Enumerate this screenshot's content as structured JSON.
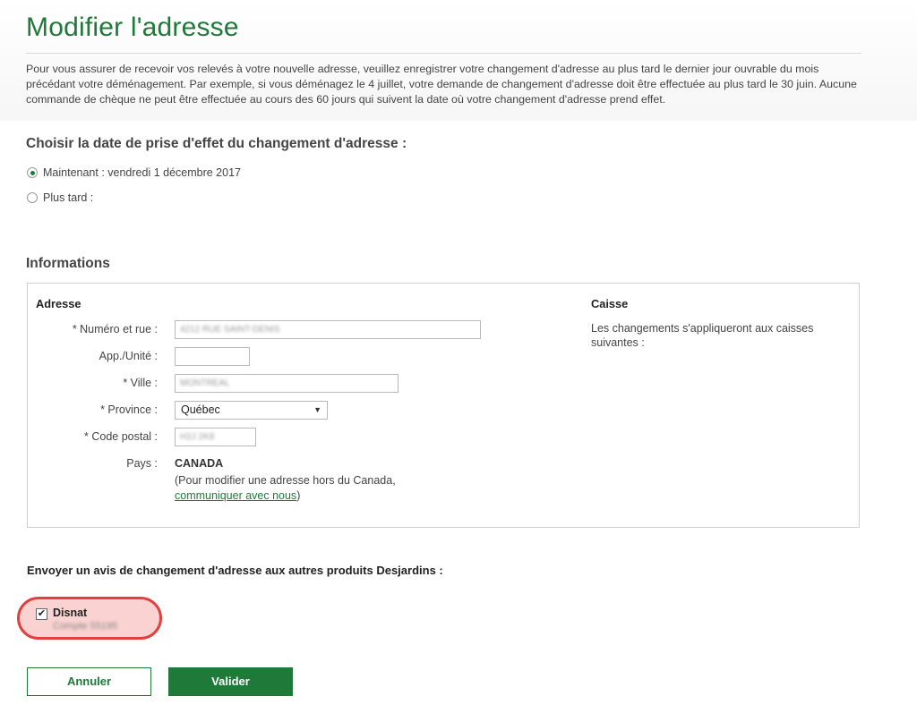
{
  "page": {
    "title": "Modifier l'adresse",
    "intro": "Pour vous assurer de recevoir vos relevés à votre nouvelle adresse, veuillez enregistrer votre changement d'adresse au plus tard le dernier jour ouvrable du mois précédant votre déménagement. Par exemple, si vous déménagez le 4 juillet, votre demande de changement d'adresse doit être effectuée au plus tard le 30 juin. Aucune commande de chèque ne peut être effectuée au cours des 60 jours qui suivent la date où votre changement d'adresse prend effet."
  },
  "date_section": {
    "title": "Choisir la date de prise d'effet du changement d'adresse :",
    "options": [
      {
        "label": "Maintenant : vendredi 1 décembre 2017",
        "checked": true
      },
      {
        "label": "Plus tard :",
        "checked": false
      }
    ]
  },
  "info_section": {
    "title": "Informations",
    "address": {
      "heading": "Adresse",
      "street_label": "* Numéro et rue :",
      "street_value": "4212 RUE SAINT-DENIS",
      "unit_label": "App./Unité :",
      "unit_value": "",
      "city_label": "* Ville :",
      "city_value": "MONTREAL",
      "province_label": "* Province :",
      "province_value": "Québec",
      "postal_label": "* Code postal :",
      "postal_value": "H2J 2K8",
      "country_label": "Pays :",
      "country_value": "CANADA",
      "country_note_prefix": "(Pour modifier une adresse hors du Canada,",
      "country_note_link": "communiquer avec nous",
      "country_note_suffix": ")"
    },
    "caisse": {
      "heading": "Caisse",
      "text": "Les changements s'appliqueront aux caisses suivantes :"
    }
  },
  "notice_section": {
    "title": "Envoyer un avis de changement d'adresse aux autres produits Desjardins :",
    "product_label": "Disnat",
    "product_sub": "Compte 55195",
    "checked": true
  },
  "buttons": {
    "cancel": "Annuler",
    "submit": "Valider"
  },
  "colors": {
    "brand_green": "#1f7a3a",
    "highlight_red": "#e04040"
  }
}
